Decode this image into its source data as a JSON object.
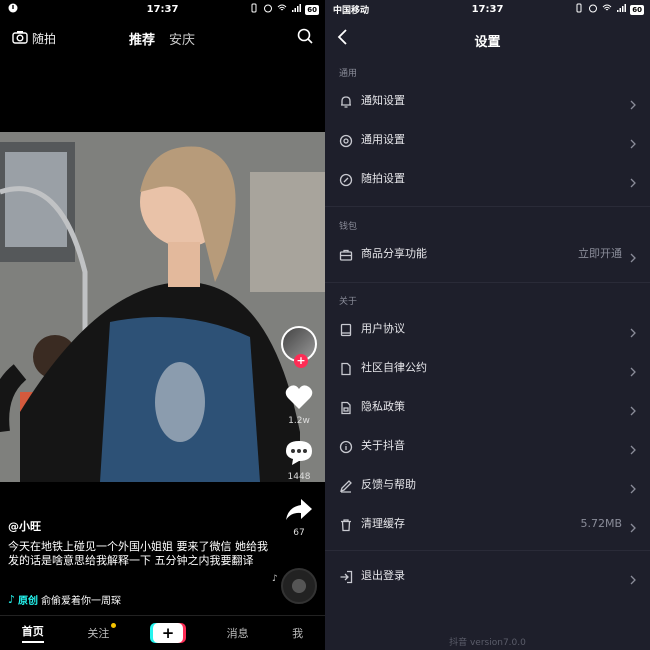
{
  "left": {
    "status": {
      "time": "17:37",
      "battery": "60"
    },
    "topnav": {
      "camera_label": "随拍",
      "tab_recommend": "推荐",
      "tab_city": "安庆"
    },
    "actions": {
      "likes": "1.2w",
      "comments": "1448",
      "shares": "67"
    },
    "caption": {
      "username": "@小旺",
      "description": "今天在地铁上碰见一个外国小姐姐 要来了微信 她给我发的话是啥意思给我解释一下 五分钟之内我要翻译"
    },
    "music": {
      "original_label": "原创",
      "track": "俞偷爱着你一周琛"
    },
    "bottom_nav": {
      "home": "首页",
      "follow": "关注",
      "plus": "+",
      "messages": "消息",
      "me": "我"
    }
  },
  "right": {
    "status": {
      "carrier": "中国移动",
      "time": "17:37",
      "battery": "60"
    },
    "title": "设置",
    "sections": {
      "general": {
        "title": "通用",
        "items": [
          {
            "label": "通知设置",
            "icon": "bell-icon"
          },
          {
            "label": "通用设置",
            "icon": "gear-icon"
          },
          {
            "label": "随拍设置",
            "icon": "clock-icon"
          }
        ]
      },
      "wallet": {
        "title": "钱包",
        "items": [
          {
            "label": "商品分享功能",
            "value": "立即开通",
            "icon": "briefcase-icon"
          }
        ]
      },
      "about": {
        "title": "关于",
        "items": [
          {
            "label": "用户协议",
            "icon": "book-icon"
          },
          {
            "label": "社区自律公约",
            "icon": "document-icon"
          },
          {
            "label": "隐私政策",
            "icon": "lock-icon"
          },
          {
            "label": "关于抖音",
            "icon": "info-icon"
          },
          {
            "label": "反馈与帮助",
            "icon": "pencil-icon"
          },
          {
            "label": "清理缓存",
            "value": "5.72MB",
            "icon": "trash-icon"
          }
        ]
      }
    },
    "logout": {
      "label": "退出登录",
      "icon": "logout-icon"
    },
    "version": "抖音 version7.0.0"
  }
}
